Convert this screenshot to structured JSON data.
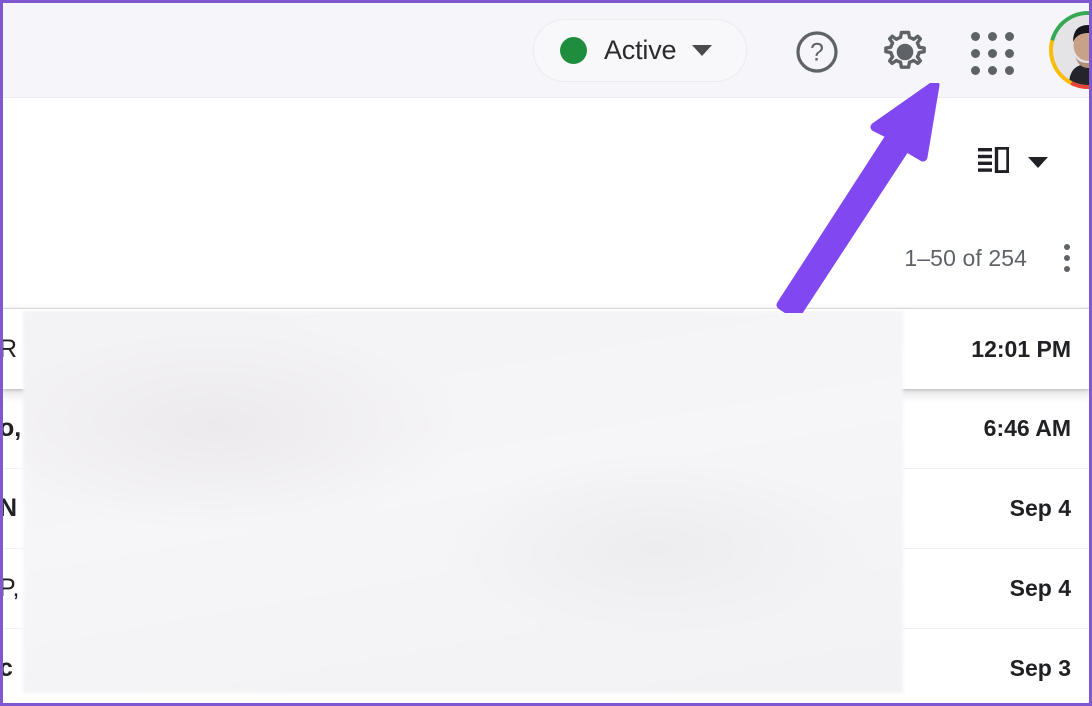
{
  "window": {
    "accent_border_color": "#7e57d1",
    "header_bg": "#f6f6fa",
    "body_bg": "#ffffff"
  },
  "header": {
    "status": {
      "label": "Active",
      "dot_color": "#1e8e3e",
      "caret_icon": "chevron-down-icon"
    },
    "icons": [
      {
        "name": "help-icon",
        "glyph": "?"
      },
      {
        "name": "gear-icon",
        "glyph": "settings"
      },
      {
        "name": "apps-grid-icon",
        "glyph": "grid-3x3"
      }
    ],
    "avatar": {
      "name": "account-avatar",
      "ring_colors": [
        "#ea4335",
        "#fbbc05",
        "#34a853",
        "#4285f4"
      ]
    }
  },
  "toolbar": {
    "pane_toggle": {
      "icon": "reading-pane-icon",
      "caret_icon": "chevron-down-icon"
    },
    "pagination_count": "1–50 of 254",
    "overflow_icon": "more-vertical-icon"
  },
  "mail_list": {
    "rows": [
      {
        "snippet": "R",
        "time": "12:01 PM",
        "bold": false,
        "elevated": true
      },
      {
        "snippet": "o,",
        "time": "6:46 AM",
        "bold": true,
        "elevated": false
      },
      {
        "snippet": "N",
        "time": "Sep 4",
        "bold": true,
        "elevated": false
      },
      {
        "snippet": "P,",
        "time": "Sep 4",
        "bold": false,
        "elevated": false
      },
      {
        "snippet": "c",
        "time": "Sep 3",
        "bold": true,
        "elevated": false
      }
    ]
  },
  "annotation": {
    "type": "arrow",
    "color": "#8147f0",
    "points_to": "gear-icon",
    "direction": "up-right"
  }
}
